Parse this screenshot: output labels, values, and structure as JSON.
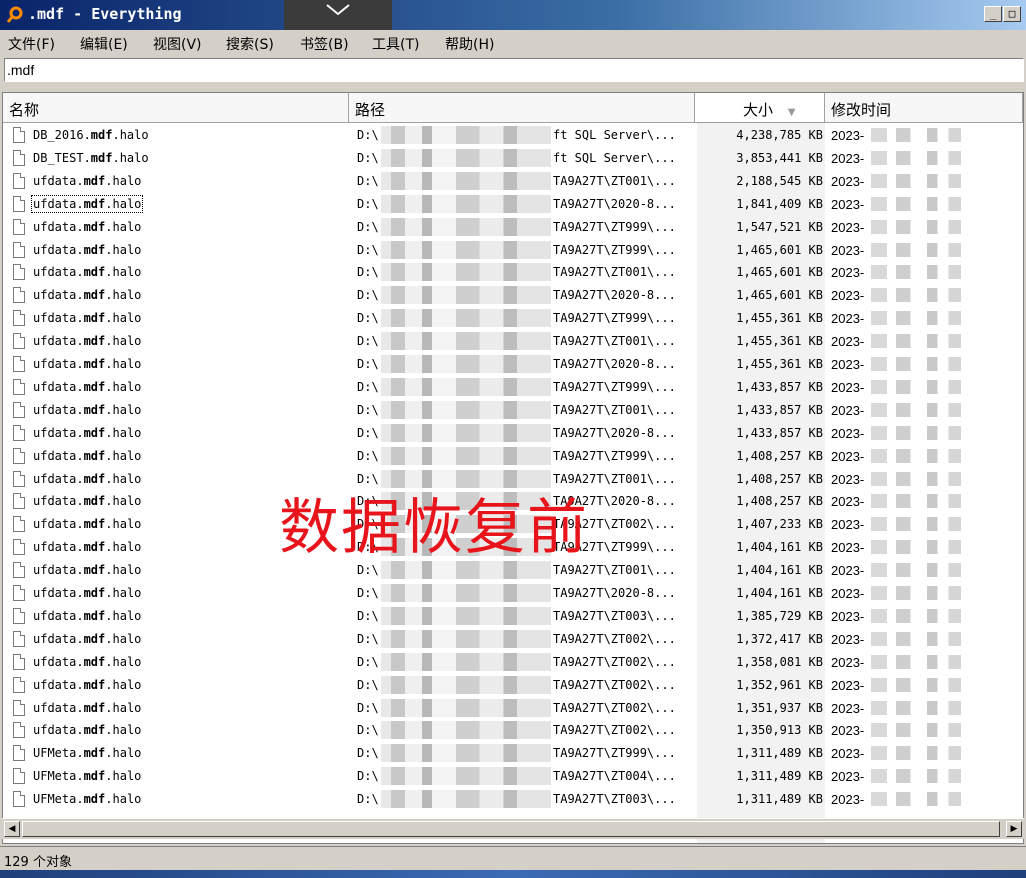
{
  "window": {
    "title": ".mdf - Everything"
  },
  "menu": [
    "文件(F)",
    "编辑(E)",
    "视图(V)",
    "搜索(S)",
    "书签(B)",
    "工具(T)",
    "帮助(H)"
  ],
  "search": {
    "value": ".mdf"
  },
  "columns": {
    "name": "名称",
    "path": "路径",
    "size": "大小",
    "modified": "修改时间"
  },
  "sort": {
    "column": "size",
    "direction": "descending"
  },
  "rows": [
    {
      "name_pre": "DB_2016.",
      "name_post": ".halo",
      "path_pre": "D:\\",
      "path_post": "ft SQL Server\\...",
      "size": "4,238,785 KB",
      "date": "2023-"
    },
    {
      "name_pre": "DB_TEST.",
      "name_post": ".halo",
      "path_pre": "D:\\",
      "path_post": "ft SQL Server\\...",
      "size": "3,853,441 KB",
      "date": "2023-"
    },
    {
      "name_pre": "ufdata.",
      "name_post": ".halo",
      "path_pre": "D:\\",
      "path_post": "TA9A27T\\ZT001\\...",
      "size": "2,188,545 KB",
      "date": "2023-"
    },
    {
      "name_pre": "ufdata.",
      "name_post": ".halo",
      "path_pre": "D:\\",
      "path_post": "TA9A27T\\2020-8...",
      "size": "1,841,409 KB",
      "date": "2023-"
    },
    {
      "name_pre": "ufdata.",
      "name_post": ".halo",
      "path_pre": "D:\\",
      "path_post": "TA9A27T\\ZT999\\...",
      "size": "1,547,521 KB",
      "date": "2023-"
    },
    {
      "name_pre": "ufdata.",
      "name_post": ".halo",
      "path_pre": "D:\\",
      "path_post": "TA9A27T\\ZT999\\...",
      "size": "1,465,601 KB",
      "date": "2023-"
    },
    {
      "name_pre": "ufdata.",
      "name_post": ".halo",
      "path_pre": "D:\\",
      "path_post": "TA9A27T\\ZT001\\...",
      "size": "1,465,601 KB",
      "date": "2023-"
    },
    {
      "name_pre": "ufdata.",
      "name_post": ".halo",
      "path_pre": "D:\\",
      "path_post": "TA9A27T\\2020-8...",
      "size": "1,465,601 KB",
      "date": "2023-"
    },
    {
      "name_pre": "ufdata.",
      "name_post": ".halo",
      "path_pre": "D:\\",
      "path_post": "TA9A27T\\ZT999\\...",
      "size": "1,455,361 KB",
      "date": "2023-"
    },
    {
      "name_pre": "ufdata.",
      "name_post": ".halo",
      "path_pre": "D:\\",
      "path_post": "TA9A27T\\ZT001\\...",
      "size": "1,455,361 KB",
      "date": "2023-"
    },
    {
      "name_pre": "ufdata.",
      "name_post": ".halo",
      "path_pre": "D:\\",
      "path_post": "TA9A27T\\2020-8...",
      "size": "1,455,361 KB",
      "date": "2023-"
    },
    {
      "name_pre": "ufdata.",
      "name_post": ".halo",
      "path_pre": "D:\\",
      "path_post": "TA9A27T\\ZT999\\...",
      "size": "1,433,857 KB",
      "date": "2023-"
    },
    {
      "name_pre": "ufdata.",
      "name_post": ".halo",
      "path_pre": "D:\\",
      "path_post": "TA9A27T\\ZT001\\...",
      "size": "1,433,857 KB",
      "date": "2023-"
    },
    {
      "name_pre": "ufdata.",
      "name_post": ".halo",
      "path_pre": "D:\\",
      "path_post": "TA9A27T\\2020-8...",
      "size": "1,433,857 KB",
      "date": "2023-"
    },
    {
      "name_pre": "ufdata.",
      "name_post": ".halo",
      "path_pre": "D:\\",
      "path_post": "TA9A27T\\ZT999\\...",
      "size": "1,408,257 KB",
      "date": "2023-"
    },
    {
      "name_pre": "ufdata.",
      "name_post": ".halo",
      "path_pre": "D:\\",
      "path_post": "TA9A27T\\ZT001\\...",
      "size": "1,408,257 KB",
      "date": "2023-"
    },
    {
      "name_pre": "ufdata.",
      "name_post": ".halo",
      "path_pre": "D:\\",
      "path_post": "TA9A27T\\2020-8...",
      "size": "1,408,257 KB",
      "date": "2023-"
    },
    {
      "name_pre": "ufdata.",
      "name_post": ".halo",
      "path_pre": "D:\\",
      "path_post": "TA9A27T\\ZT002\\...",
      "size": "1,407,233 KB",
      "date": "2023-"
    },
    {
      "name_pre": "ufdata.",
      "name_post": ".halo",
      "path_pre": "D:\\",
      "path_post": "TA9A27T\\ZT999\\...",
      "size": "1,404,161 KB",
      "date": "2023-"
    },
    {
      "name_pre": "ufdata.",
      "name_post": ".halo",
      "path_pre": "D:\\",
      "path_post": "TA9A27T\\ZT001\\...",
      "size": "1,404,161 KB",
      "date": "2023-"
    },
    {
      "name_pre": "ufdata.",
      "name_post": ".halo",
      "path_pre": "D:\\",
      "path_post": "TA9A27T\\2020-8...",
      "size": "1,404,161 KB",
      "date": "2023-"
    },
    {
      "name_pre": "ufdata.",
      "name_post": ".halo",
      "path_pre": "D:\\",
      "path_post": "TA9A27T\\ZT003\\...",
      "size": "1,385,729 KB",
      "date": "2023-"
    },
    {
      "name_pre": "ufdata.",
      "name_post": ".halo",
      "path_pre": "D:\\",
      "path_post": "TA9A27T\\ZT002\\...",
      "size": "1,372,417 KB",
      "date": "2023-"
    },
    {
      "name_pre": "ufdata.",
      "name_post": ".halo",
      "path_pre": "D:\\",
      "path_post": "TA9A27T\\ZT002\\...",
      "size": "1,358,081 KB",
      "date": "2023-"
    },
    {
      "name_pre": "ufdata.",
      "name_post": ".halo",
      "path_pre": "D:\\",
      "path_post": "TA9A27T\\ZT002\\...",
      "size": "1,352,961 KB",
      "date": "2023-"
    },
    {
      "name_pre": "ufdata.",
      "name_post": ".halo",
      "path_pre": "D:\\",
      "path_post": "TA9A27T\\ZT002\\...",
      "size": "1,351,937 KB",
      "date": "2023-"
    },
    {
      "name_pre": "ufdata.",
      "name_post": ".halo",
      "path_pre": "D:\\",
      "path_post": "TA9A27T\\ZT002\\...",
      "size": "1,350,913 KB",
      "date": "2023-"
    },
    {
      "name_pre": "UFMeta.",
      "name_post": ".halo",
      "path_pre": "D:\\",
      "path_post": "TA9A27T\\ZT999\\...",
      "size": "1,311,489 KB",
      "date": "2023-"
    },
    {
      "name_pre": "UFMeta.",
      "name_post": ".halo",
      "path_pre": "D:\\",
      "path_post": "TA9A27T\\ZT004\\...",
      "size": "1,311,489 KB",
      "date": "2023-"
    },
    {
      "name_pre": "UFMeta.",
      "name_post": ".halo",
      "path_pre": "D:\\",
      "path_post": "TA9A27T\\ZT003\\...",
      "size": "1,311,489 KB",
      "date": "2023-"
    }
  ],
  "name_highlight": "mdf",
  "focused_row": 3,
  "status": "129 个对象",
  "overlay_text": "数据恢复前",
  "colors": {
    "overlay": "#e8141c",
    "title_bar": "#0a246a",
    "search_icon": "#ff8c00"
  }
}
